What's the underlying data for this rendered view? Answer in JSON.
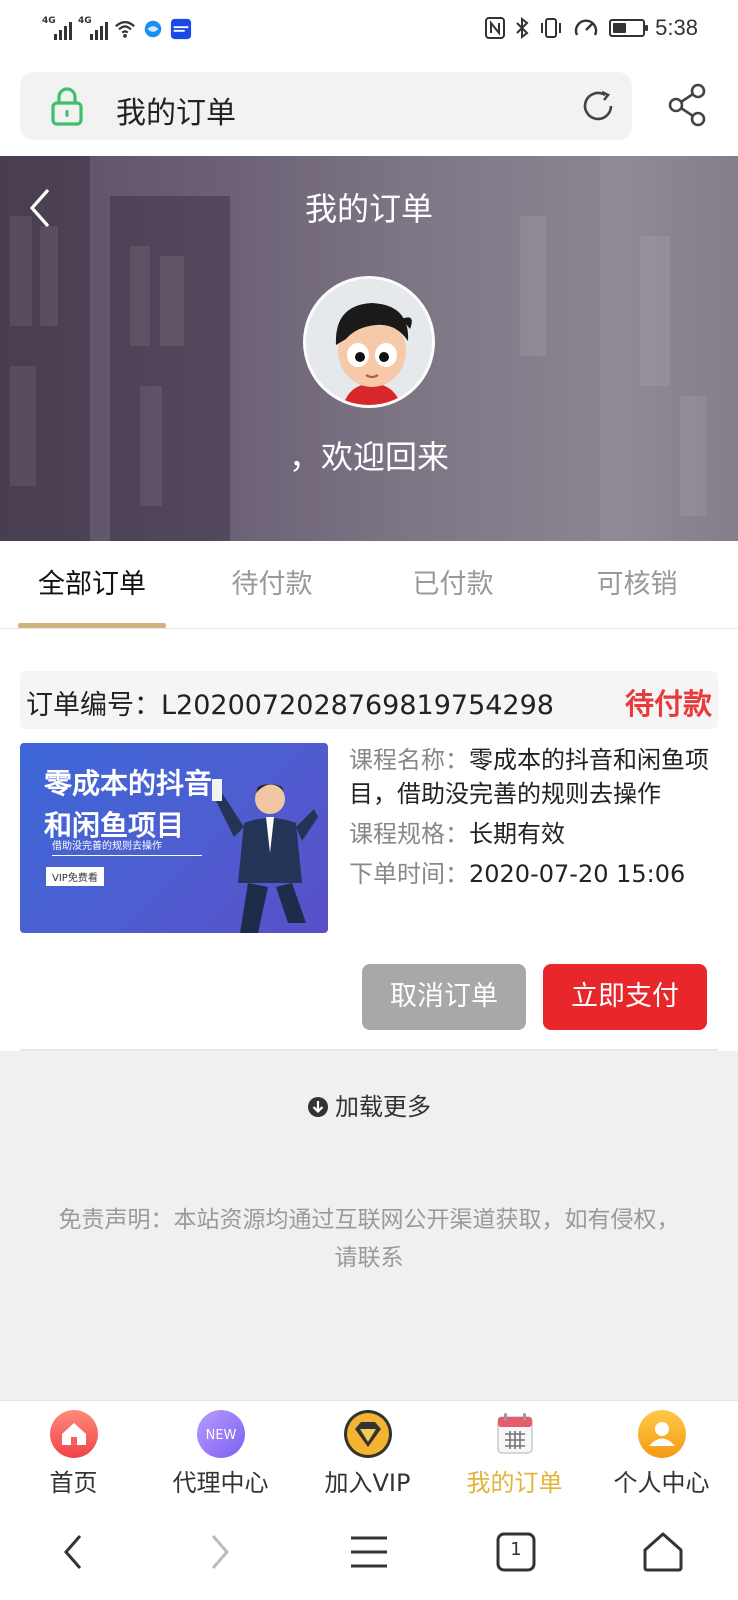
{
  "status_bar": {
    "network_1": "4G",
    "network_2": "4G",
    "time": "5:38",
    "battery_level": 0.45,
    "icons": [
      "signal-icon",
      "signal-icon",
      "wifi-icon",
      "browser-app-icon",
      "app-notification-icon",
      "nfc-icon",
      "bluetooth-icon",
      "vibrate-icon",
      "data-saver-icon",
      "battery-icon"
    ]
  },
  "browser": {
    "address_title": "我的订单",
    "icons": [
      "lock-icon",
      "reload-icon",
      "share-icon"
    ]
  },
  "hero": {
    "title": "我的订单",
    "welcome": "，欢迎回来"
  },
  "tabs": [
    {
      "label": "全部订单",
      "active": true
    },
    {
      "label": "待付款",
      "active": false
    },
    {
      "label": "已付款",
      "active": false
    },
    {
      "label": "可核销",
      "active": false
    }
  ],
  "order": {
    "number_label": "订单编号：",
    "number": "L20200720287698197542​98",
    "status": "待付款",
    "thumbnail": {
      "headline": "零成本的抖音和闲鱼项目",
      "subline": "借助没完善的规则去操作",
      "badge": "VIP免费看"
    },
    "course_name_label": "课程名称：",
    "course_name": "零成本的抖音和闲鱼项目，借助没完善的规则去操作",
    "spec_label": "课程规格：",
    "spec": "长期有效",
    "time_label": "下单时间：",
    "time": "2020-07-20 15:06",
    "cancel_label": "取消订单",
    "pay_label": "立即支付"
  },
  "load_more": "加载更多",
  "disclaimer": "免责声明：本站资源均通过互联网公开渠道获取，如有侵权，请联系",
  "tabbar": [
    {
      "label": "首页",
      "icon": "home-icon"
    },
    {
      "label": "代理中心",
      "icon": "new-badge-icon",
      "badge": "NEW"
    },
    {
      "label": "加入VIP",
      "icon": "vip-diamond-icon"
    },
    {
      "label": "我的订单",
      "icon": "calendar-orders-icon",
      "active": true
    },
    {
      "label": "个人中心",
      "icon": "user-icon"
    }
  ],
  "system_nav": {
    "tab_count": "1",
    "icons": [
      "back-arrow-icon",
      "forward-arrow-icon",
      "menu-icon",
      "tabs-icon",
      "home-outline-icon"
    ]
  },
  "colors": {
    "accent_underline": "#d4b27d",
    "status_red": "#e8393b",
    "pay_button": "#e8272a",
    "cancel_button": "#a8a8a8",
    "active_tab_label": "#e3b43a"
  }
}
